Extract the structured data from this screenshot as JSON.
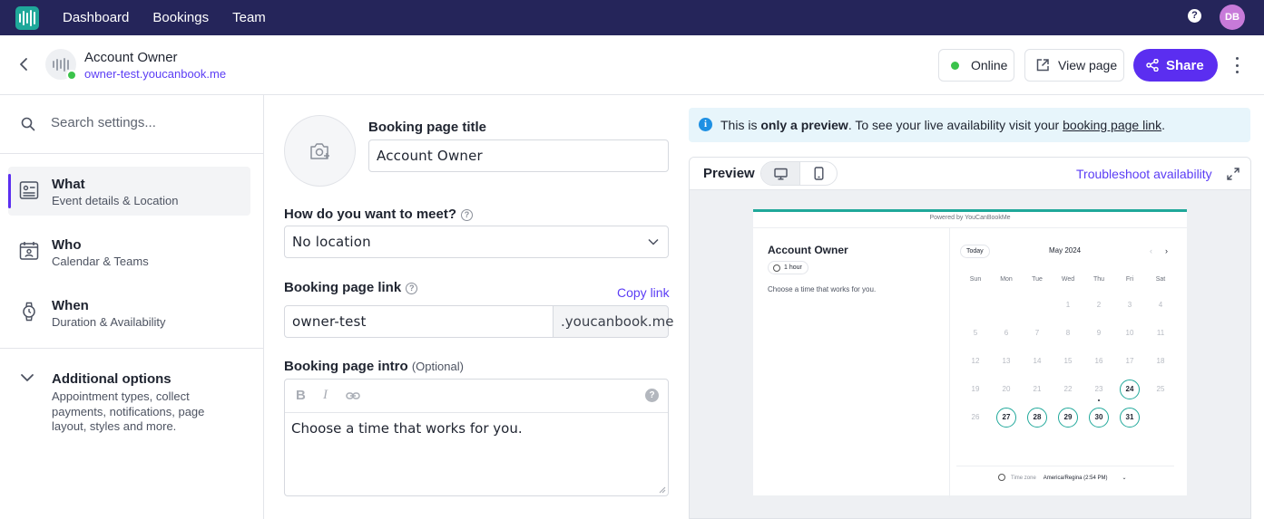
{
  "nav": {
    "items": [
      "Dashboard",
      "Bookings",
      "Team"
    ],
    "help_icon": "?",
    "avatar_initials": "DB"
  },
  "account": {
    "name": "Account Owner",
    "url": "owner-test.youcanbook.me",
    "online_label": "Online",
    "view_page_label": "View page",
    "share_label": "Share"
  },
  "sidebar": {
    "search_placeholder": "Search settings...",
    "items": [
      {
        "title": "What",
        "subtitle": "Event details & Location",
        "icon": "id-card-icon"
      },
      {
        "title": "Who",
        "subtitle": "Calendar & Teams",
        "icon": "calendar-person-icon"
      },
      {
        "title": "When",
        "subtitle": "Duration & Availability",
        "icon": "watch-icon"
      }
    ],
    "additional": {
      "title": "Additional options",
      "subtitle": "Appointment types, collect payments, notifications, page layout, styles and more."
    }
  },
  "form": {
    "title_label": "Booking page title",
    "title_value": "Account Owner",
    "meet_label": "How do you want to meet?",
    "meet_value": "No location",
    "link_label": "Booking page link",
    "copy_link": "Copy link",
    "link_value": "owner-test",
    "link_suffix": ".youcanbook.me",
    "intro_label": "Booking page intro",
    "intro_optional": "(Optional)",
    "intro_value": "Choose a time that works for you.",
    "toolbar": {
      "bold": "B",
      "italic": "I"
    }
  },
  "preview": {
    "notice_prefix": "This is ",
    "notice_bold": "only a preview",
    "notice_mid": ". To see your live availability visit your ",
    "notice_link": "booking page link",
    "notice_end": ".",
    "title": "Preview",
    "troubleshoot": "Troubleshoot availability",
    "mini": {
      "powered": "Powered by YouCanBookMe",
      "name": "Account Owner",
      "duration": "1 hour",
      "intro": "Choose a time that works for you.",
      "today_label": "Today",
      "month": "May 2024",
      "weekdays": [
        "Sun",
        "Mon",
        "Tue",
        "Wed",
        "Thu",
        "Fri",
        "Sat"
      ],
      "weeks": [
        [
          "",
          "",
          "",
          "1",
          "2",
          "3",
          "4"
        ],
        [
          "5",
          "6",
          "7",
          "8",
          "9",
          "10",
          "11"
        ],
        [
          "12",
          "13",
          "14",
          "15",
          "16",
          "17",
          "18"
        ],
        [
          "19",
          "20",
          "21",
          "22",
          "23",
          "24",
          "25"
        ],
        [
          "26",
          "27",
          "28",
          "29",
          "30",
          "31",
          ""
        ]
      ],
      "available_days": [
        "24",
        "27",
        "28",
        "29",
        "30",
        "31"
      ],
      "today": "23",
      "timezone_label": "Time zone",
      "timezone_value": "America/Regina (2:54 PM)"
    }
  },
  "colors": {
    "nav_bg": "#25255a",
    "accent": "#5b2ef0",
    "brand_teal": "#1fa89a",
    "online_green": "#3bc34b"
  }
}
